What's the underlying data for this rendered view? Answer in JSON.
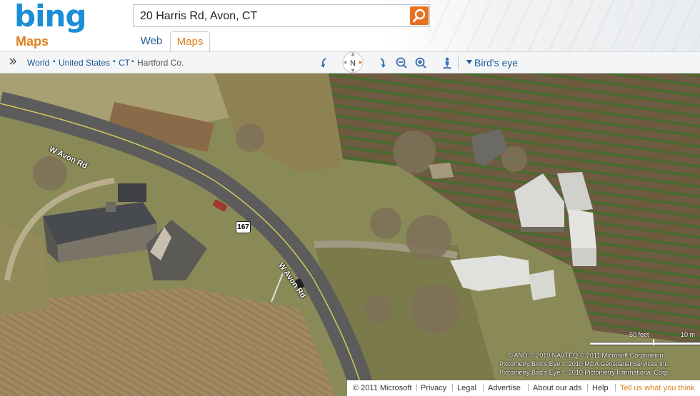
{
  "header": {
    "logo": "bing",
    "logo_sub": "Maps",
    "search_value": "20 Harris Rd, Avon, CT",
    "search_icon": "search-icon",
    "tabs": [
      {
        "label": "Web",
        "active": false
      },
      {
        "label": "Maps",
        "active": true
      }
    ]
  },
  "breadcrumb": {
    "items": [
      "World",
      "United States",
      "CT",
      "Hartford Co."
    ],
    "separator": "▪"
  },
  "toolbar": {
    "compass_label": "N",
    "view_mode": "Bird's eye",
    "icons": [
      "rotate-left-icon",
      "compass-icon",
      "rotate-right-icon",
      "zoom-out-icon",
      "zoom-in-icon",
      "streetside-person-icon"
    ]
  },
  "map": {
    "road_labels": [
      "W Avon Rd",
      "W Avon Rd"
    ],
    "route_shield": "167",
    "scale": {
      "label_1": "50 feet",
      "label_2": "10 m"
    },
    "copyright": [
      "© AND  © 2010 NAVTEQ  © 2011 Microsoft Corporation",
      "Pictometry Bird's Eye © 2010 MDA Geospatial Services Inc.",
      "Pictometry Bird's Eye © 2010 Pictometry International Corp."
    ]
  },
  "footer": {
    "items": [
      "© 2011 Microsoft",
      "Privacy",
      "Legal",
      "Advertise",
      "About our ads",
      "Help",
      "Tell us what you think"
    ]
  },
  "colors": {
    "brand_blue": "#1a8ed6",
    "brand_orange": "#e0801c",
    "link_blue": "#1e5a99"
  }
}
